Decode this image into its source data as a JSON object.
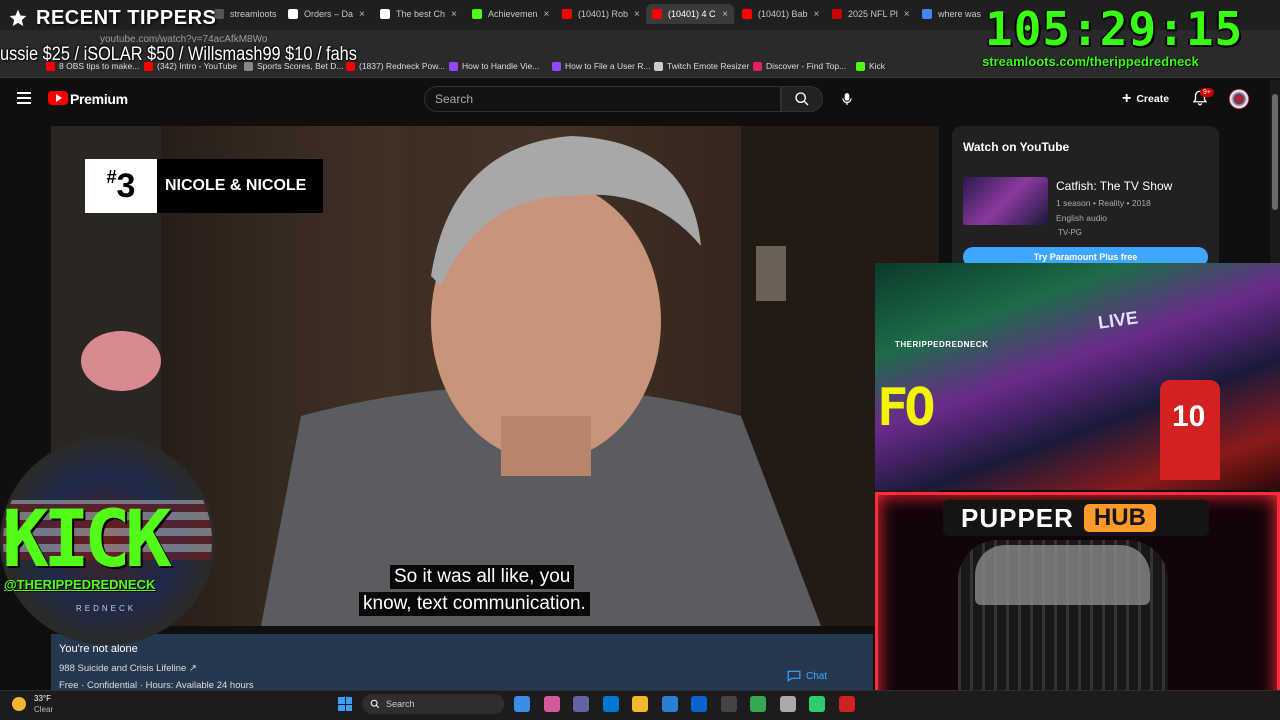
{
  "browser": {
    "tabs": [
      {
        "label": "streamloots",
        "color": "#555555",
        "active": false
      },
      {
        "label": "Orders – Da",
        "color": "#ffffff",
        "active": false
      },
      {
        "label": "The best Ch",
        "color": "#ffffff",
        "active": false
      },
      {
        "label": "Achievemen",
        "color": "#53fc18",
        "active": false
      },
      {
        "label": "(10401) Rob",
        "color": "#ff0000",
        "active": false
      },
      {
        "label": "(10401) 4 C",
        "color": "#ff0000",
        "active": true
      },
      {
        "label": "(10401) Bab",
        "color": "#ff0000",
        "active": false
      },
      {
        "label": "2025 NFL Pl",
        "color": "#cc0000",
        "active": false
      },
      {
        "label": "where was",
        "color": "#4285f4",
        "active": false
      }
    ],
    "url": "youtube.com/watch?v=74acAfkM8Wo",
    "bookmarks": [
      {
        "label": "8 OBS tips to make...",
        "color": "#ff0000"
      },
      {
        "label": "(342) Intro - YouTube",
        "color": "#ff0000"
      },
      {
        "label": "Sports Scores, Bet D...",
        "color": "#888888"
      },
      {
        "label": "(1837) Redneck Pow...",
        "color": "#ff0000"
      },
      {
        "label": "How to Handle Vie...",
        "color": "#9146ff"
      },
      {
        "label": "How to File a User R...",
        "color": "#9146ff"
      },
      {
        "label": "Twitch Emote Resizer",
        "color": "#cccccc"
      },
      {
        "label": "Discover - Find Top...",
        "color": "#e02060"
      },
      {
        "label": "Kick",
        "color": "#53fc18"
      }
    ]
  },
  "overlay": {
    "tippers_title": "RECENT TIPPERS",
    "tippers_ticker": "ussie $25 / iSOLAR $50 / Willsmash99 $10 / fahs",
    "timer": "105:29:15",
    "loots_url": "streamloots.com/therippedredneck",
    "kick_text": "KICK",
    "kick_handle": "@THERIPPEDREDNECK",
    "redneck_label": "REDNECK",
    "webcam_live": "LIVE",
    "webcam_name": "THERIPPEDREDNECK",
    "webcam_fo": "FO",
    "jersey_number": "10",
    "pupper": "PUPPER",
    "hub": "HUB"
  },
  "youtube": {
    "brand": "Premium",
    "search_placeholder": "Search",
    "create_label": "Create",
    "notifications": "9+",
    "rank_number": "3",
    "rank_hash": "#",
    "rank_label": "NICOLE & NICOLE",
    "caption_line1": "So it was all like, you",
    "caption_line2": "know, text communication.",
    "crisis_title": "You're not alone",
    "crisis_link": "988 Suicide and Crisis Lifeline ↗",
    "crisis_hours": "Free · Confidential · Hours: Available 24 hours",
    "chat_label": "Chat",
    "side_title": "Watch on YouTube",
    "show_title": "Catfish: The TV Show",
    "show_meta": "1 season • Reality • 2018",
    "show_audio": "English audio",
    "show_rating": "TV-PG",
    "try_button": "Try Paramount Plus free"
  },
  "taskbar": {
    "temperature": "33°F",
    "weather": "Clear",
    "search_label": "Search",
    "apps": [
      "#3a8ee6",
      "#d45a9a",
      "#6264a7",
      "#0078d4",
      "#f5b731",
      "#2a7fd4",
      "#0a64d0",
      "#444444",
      "#34a853",
      "#aaaaaa",
      "#2ecc71",
      "#cc2222"
    ]
  }
}
